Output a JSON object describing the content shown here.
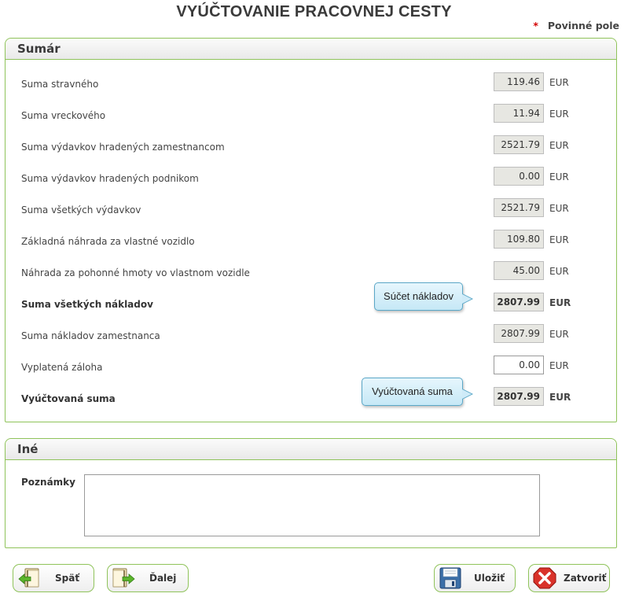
{
  "page": {
    "title": "VYÚČTOVANIE PRACOVNEJ CESTY",
    "required_marker": "*",
    "required_label": "Povinné pole"
  },
  "summary": {
    "title": "Sumár",
    "rows": [
      {
        "label": "Suma stravného",
        "value": "119.46",
        "unit": "EUR"
      },
      {
        "label": "Suma vreckového",
        "value": "11.94",
        "unit": "EUR"
      },
      {
        "label": "Suma výdavkov hradených zamestnancom",
        "value": "2521.79",
        "unit": "EUR"
      },
      {
        "label": "Suma výdavkov hradených podnikom",
        "value": "0.00",
        "unit": "EUR"
      },
      {
        "label": "Suma všetkých výdavkov",
        "value": "2521.79",
        "unit": "EUR"
      },
      {
        "label": "Základná náhrada za vlastné vozidlo",
        "value": "109.80",
        "unit": "EUR"
      },
      {
        "label": "Náhrada za pohonné hmoty vo vlastnom vozidle",
        "value": "45.00",
        "unit": "EUR"
      },
      {
        "label": "Suma všetkých nákladov",
        "value": "2807.99",
        "unit": "EUR"
      },
      {
        "label": "Suma nákladov zamestnanca",
        "value": "2807.99",
        "unit": "EUR"
      },
      {
        "label": "Vyplatená záloha",
        "value": "0.00",
        "unit": "EUR"
      },
      {
        "label": "Vyúčtovaná suma",
        "value": "2807.99",
        "unit": "EUR"
      }
    ],
    "tooltips": {
      "total_costs": "Súčet nákladov",
      "settled_amount": "Vyúčtovaná suma"
    }
  },
  "other": {
    "title": "Iné",
    "notes_label": "Poznámky",
    "notes_value": ""
  },
  "buttons": {
    "back": "Späť",
    "next": "Ďalej",
    "save": "Uložiť",
    "close": "Zatvoriť"
  },
  "icons": {
    "back": "arrow-left-book-icon",
    "next": "arrow-right-book-icon",
    "save": "floppy-disk-icon",
    "close": "red-x-icon"
  },
  "colors": {
    "panel_border": "#8fc35a",
    "tooltip_border": "#5aa7c7",
    "required_star": "#d40000",
    "close_red": "#d9322a"
  }
}
